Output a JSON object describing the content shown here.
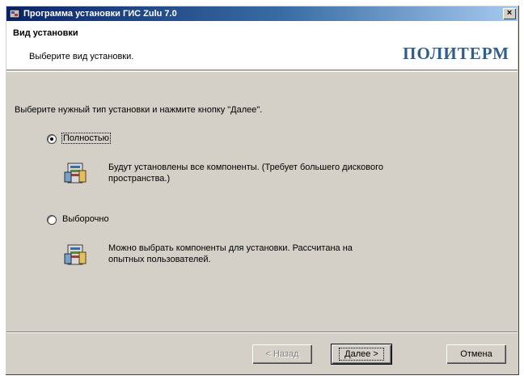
{
  "window": {
    "title": "Программа установки ГИС Zulu 7.0",
    "close_glyph": "×"
  },
  "header": {
    "title": "Вид установки",
    "subtitle": "Выберите вид установки.",
    "brand": "ПОЛИТЕРМ"
  },
  "main": {
    "instruction": "Выберите нужный тип установки и нажмите кнопку \"Далее\".",
    "options": [
      {
        "label": "Полностью",
        "selected": true,
        "description_line1": "Будут установлены все компоненты. (Требует большего дискового",
        "description_line2": "пространства.)",
        "icon": "components-icon"
      },
      {
        "label": "Выборочно",
        "selected": false,
        "description_line1": "Можно выбрать компоненты для установки. Рассчитана на",
        "description_line2": "опытных пользователей.",
        "icon": "components-icon"
      }
    ]
  },
  "buttons": {
    "back": "< Назад",
    "next": "Далее >",
    "cancel": "Отмена"
  }
}
